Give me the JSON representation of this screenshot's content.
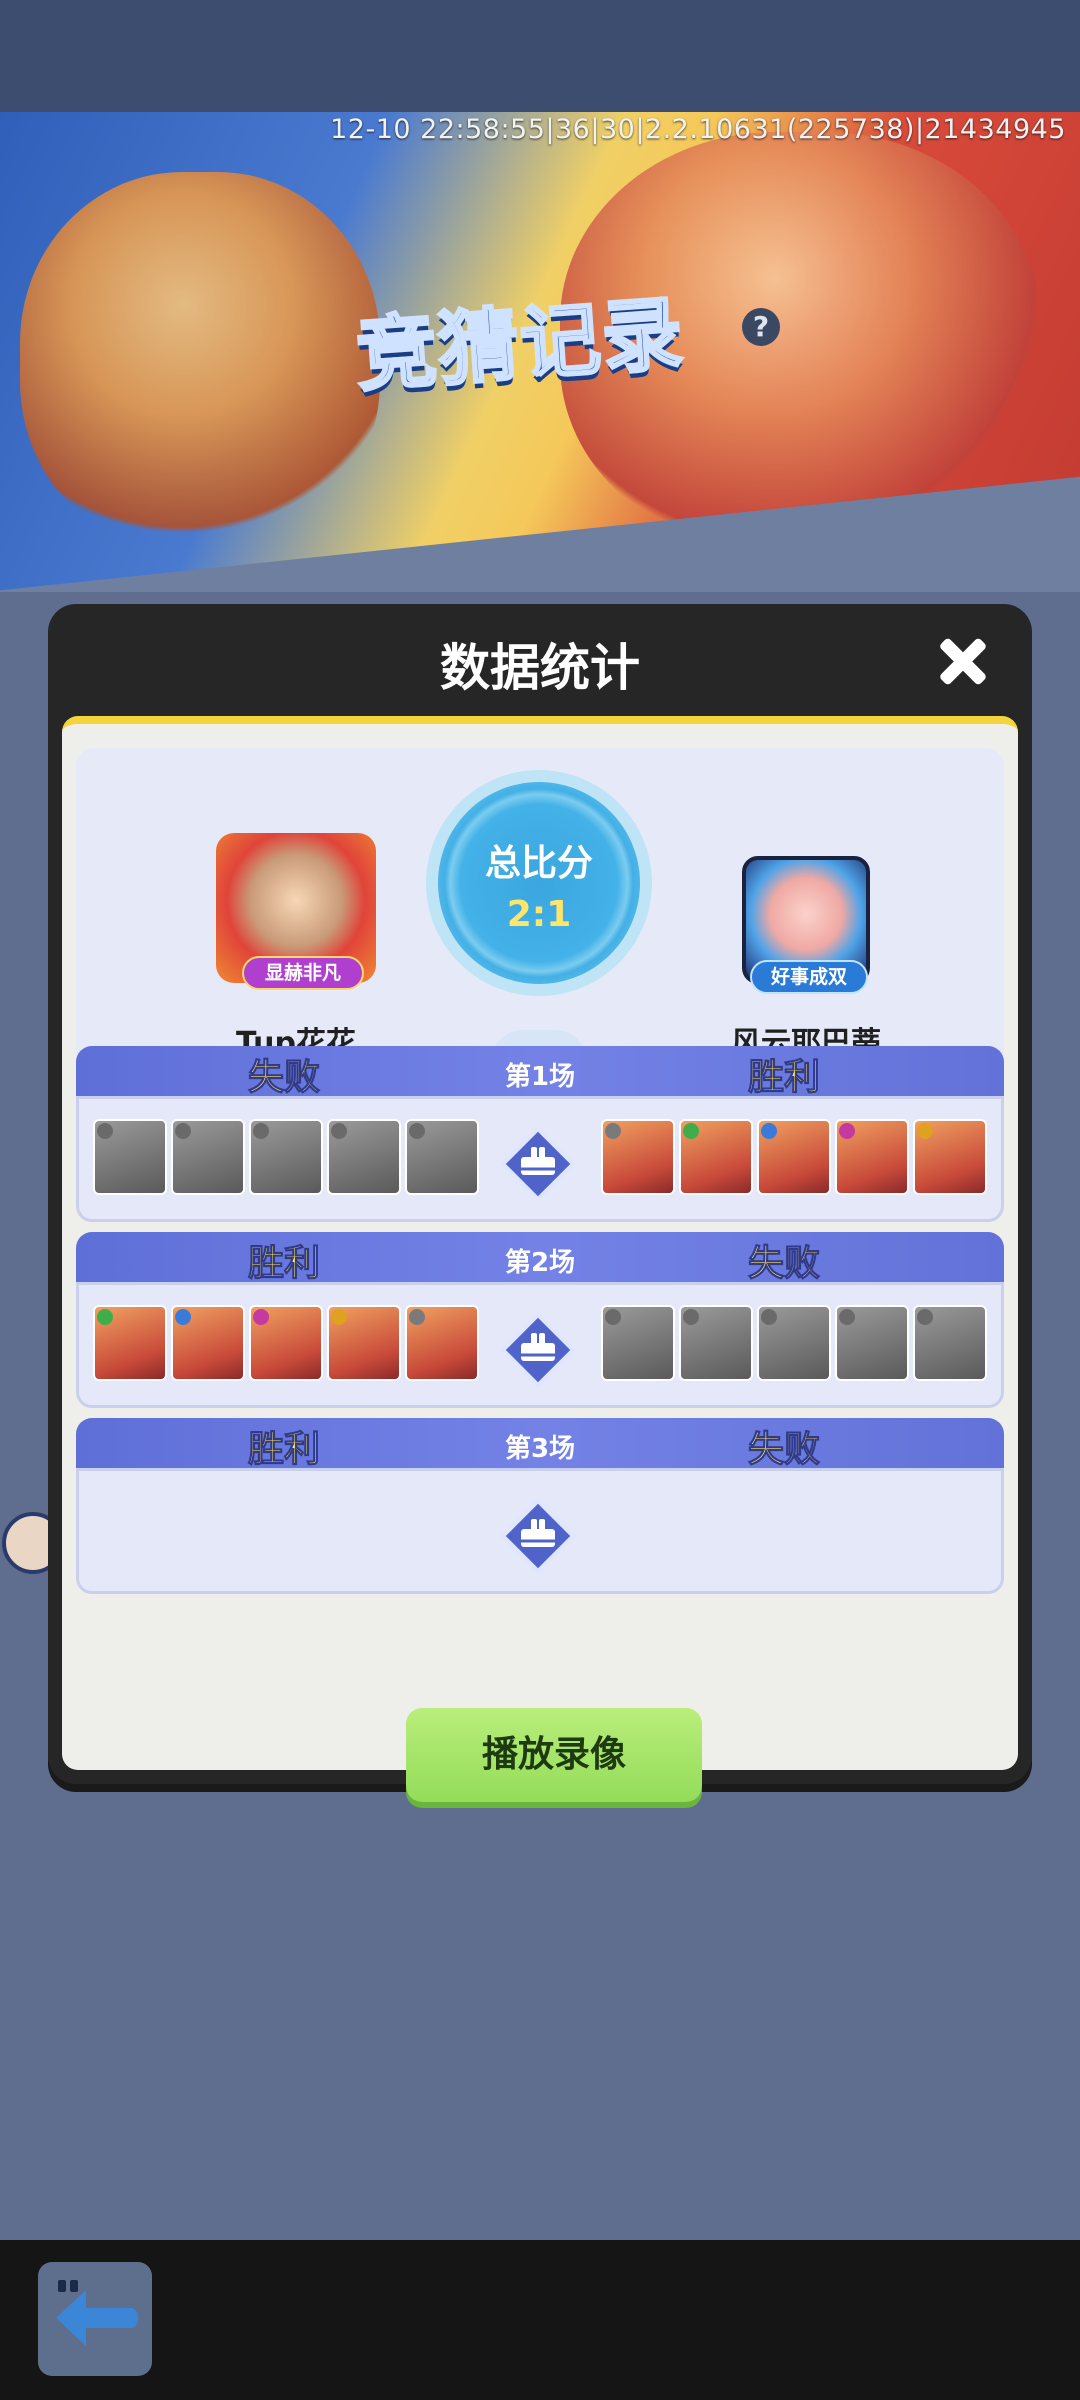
{
  "status": {
    "version_text": "12-10 22:58:55|36|30|2.2.10631(225738)|21434945"
  },
  "banner": {
    "title": "竞猜记录",
    "help_symbol": "?"
  },
  "dialog": {
    "title": "数据统计",
    "score": {
      "label": "总比分",
      "value": "2:1"
    },
    "players": {
      "left": {
        "name": "Tup花花",
        "badge": "显赫非凡"
      },
      "right": {
        "name": "风云耶巴蒂",
        "badge": "好事成双"
      }
    },
    "matches": [
      {
        "label": "第1场",
        "left_result": "失败",
        "right_result": "胜利",
        "left_cards": [
          "gray",
          "gray",
          "gray",
          "gray",
          "gray"
        ],
        "right_cards": [
          "color",
          "color",
          "color",
          "color",
          "color"
        ]
      },
      {
        "label": "第2场",
        "left_result": "胜利",
        "right_result": "失败",
        "left_cards": [
          "color",
          "color",
          "color",
          "color",
          "color"
        ],
        "right_cards": [
          "gray",
          "gray",
          "gray",
          "gray",
          "gray"
        ]
      },
      {
        "label": "第3场",
        "left_result": "胜利",
        "right_result": "失败",
        "left_cards": [],
        "right_cards": []
      }
    ],
    "replay_button": "播放录像"
  },
  "colors": {
    "accent_yellow": "#f4d43c",
    "match_bar": "#6a7be0",
    "win_text": "#ffe35a",
    "replay_green": "#a6e66a"
  },
  "icons": {
    "close": "close-icon",
    "replay": "replay-icon",
    "back": "back-arrow-icon"
  }
}
